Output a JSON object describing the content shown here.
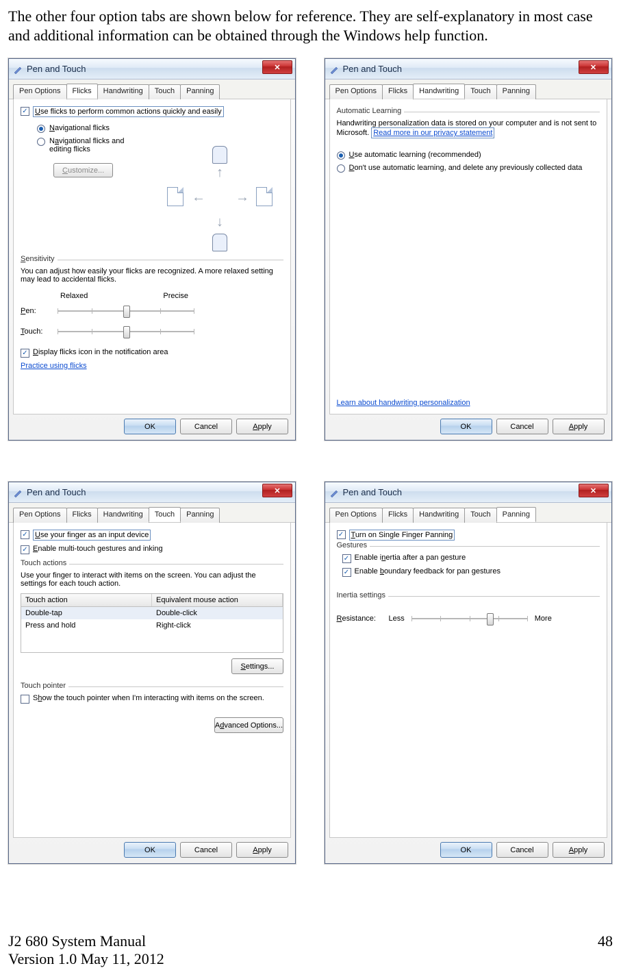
{
  "intro_text": "The other four option tabs are shown below for reference. They are self-explanatory in most case and additional information can be obtained through the Windows help function.",
  "common": {
    "window_title": "Pen and Touch",
    "tabs": [
      "Pen Options",
      "Flicks",
      "Handwriting",
      "Touch",
      "Panning"
    ],
    "ok": "OK",
    "cancel": "Cancel",
    "apply": "Apply"
  },
  "flicks": {
    "use_flicks": "Use flicks to perform common actions quickly and easily",
    "nav_flicks": "Navigational flicks",
    "nav_edit_flicks": "Navigational flicks and editing flicks",
    "customize": "Customize...",
    "sensitivity_label": "Sensitivity",
    "sensitivity_text": "You can adjust how easily your flicks are recognized. A more relaxed setting may lead to accidental flicks.",
    "relaxed": "Relaxed",
    "precise": "Precise",
    "pen": "Pen:",
    "touch": "Touch:",
    "display_icon": "Display flicks icon in the notification area",
    "practice": "Practice using flicks"
  },
  "handwriting": {
    "group_label": "Automatic Learning",
    "text1": "Handwriting personalization data is stored on your computer and is not sent to Microsoft. ",
    "privacy_link": "Read more in our privacy statement",
    "opt1": "Use automatic learning (recommended)",
    "opt2": "Don't use automatic learning, and delete any previously collected data",
    "learn_link": "Learn about handwriting personalization"
  },
  "touch": {
    "use_finger": "Use your finger as an input device",
    "enable_multi": "Enable multi-touch gestures and inking",
    "touch_actions_label": "Touch actions",
    "touch_actions_text": "Use your finger to interact with items on the screen. You can adjust the settings for each touch action.",
    "col1": "Touch action",
    "col2": "Equivalent mouse action",
    "row1a": "Double-tap",
    "row1b": "Double-click",
    "row2a": "Press and hold",
    "row2b": "Right-click",
    "settings": "Settings...",
    "touch_pointer_label": "Touch pointer",
    "touch_pointer_text": "Show the touch pointer when I'm interacting with items on the screen.",
    "advanced": "Advanced Options..."
  },
  "panning": {
    "single_finger": "Turn on Single Finger Panning",
    "gestures_label": "Gestures",
    "inertia": "Enable inertia after a pan gesture",
    "boundary": "Enable boundary feedback for pan gestures",
    "inertia_settings_label": "Inertia settings",
    "resistance": "Resistance:",
    "less": "Less",
    "more": "More"
  },
  "footer": {
    "left1": "J2 680 System Manual",
    "left2": "Version 1.0 May 11, 2012",
    "page": "48"
  }
}
